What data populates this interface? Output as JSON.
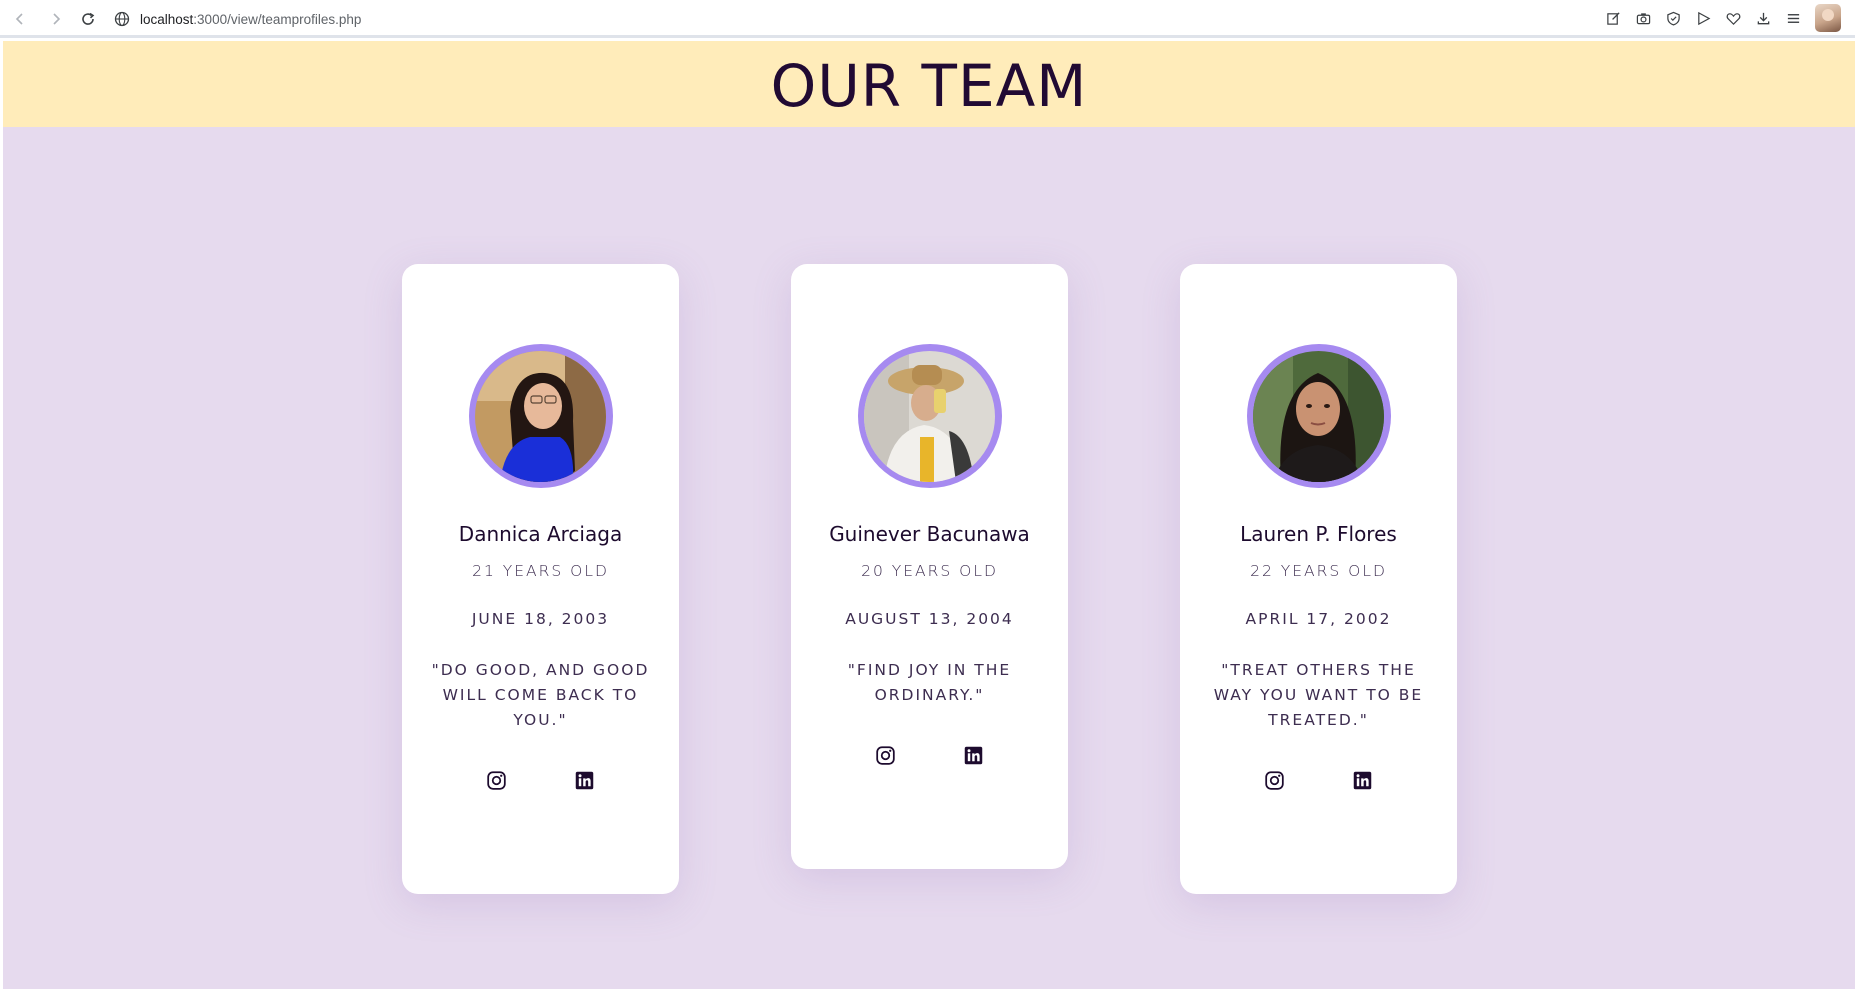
{
  "browser": {
    "url_host": "localhost",
    "url_path": ":3000/view/teamprofiles.php"
  },
  "header": {
    "title": "OUR TEAM"
  },
  "team": [
    {
      "name": "Dannica Arciaga",
      "age": "21 YEARS OLD",
      "birthday": "JUNE 18, 2003",
      "quote": "\"DO GOOD, AND GOOD WILL COME BACK TO YOU.\""
    },
    {
      "name": "Guinever Bacunawa",
      "age": "20 YEARS OLD",
      "birthday": "AUGUST 13, 2004",
      "quote": "\"FIND JOY IN THE ORDINARY.\""
    },
    {
      "name": "Lauren P. Flores",
      "age": "22 YEARS OLD",
      "birthday": "APRIL 17, 2002",
      "quote": "\"TREAT OTHERS THE WAY YOU WANT TO BE TREATED.\""
    }
  ],
  "icons": {
    "instagram": "instagram-icon",
    "linkedin": "linkedin-icon"
  },
  "colors": {
    "page_bg": "#e6daee",
    "header_bg": "#ffecba",
    "title": "#210a33",
    "avatar_ring": "#a68af0"
  }
}
